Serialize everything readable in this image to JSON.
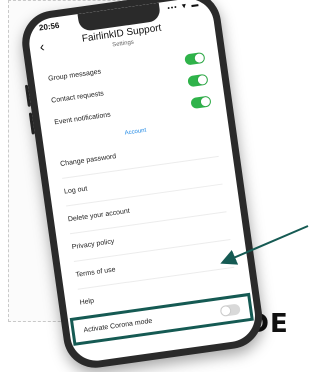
{
  "status_bar": {
    "time": "20:56",
    "icons": "••• ▼ ▬"
  },
  "header": {
    "back_icon": "chevron-left",
    "title": "FairlinkID Support",
    "subtitle": "Settings"
  },
  "notifications": [
    {
      "label": "Group messages",
      "enabled": true
    },
    {
      "label": "Contact requests",
      "enabled": true
    },
    {
      "label": "Event notifications",
      "enabled": true
    }
  ],
  "account": {
    "section_label": "Account",
    "items": [
      "Change password",
      "Log out",
      "Delete your account",
      "Privacy policy",
      "Terms of use",
      "Help"
    ]
  },
  "corona": {
    "label": "Activate Corona mode",
    "enabled": false
  },
  "colors": {
    "toggle_on": "#2fb34a",
    "accent": "#1e88e5",
    "highlight": "#155a53"
  },
  "caption": {
    "text": "QR CODE"
  }
}
